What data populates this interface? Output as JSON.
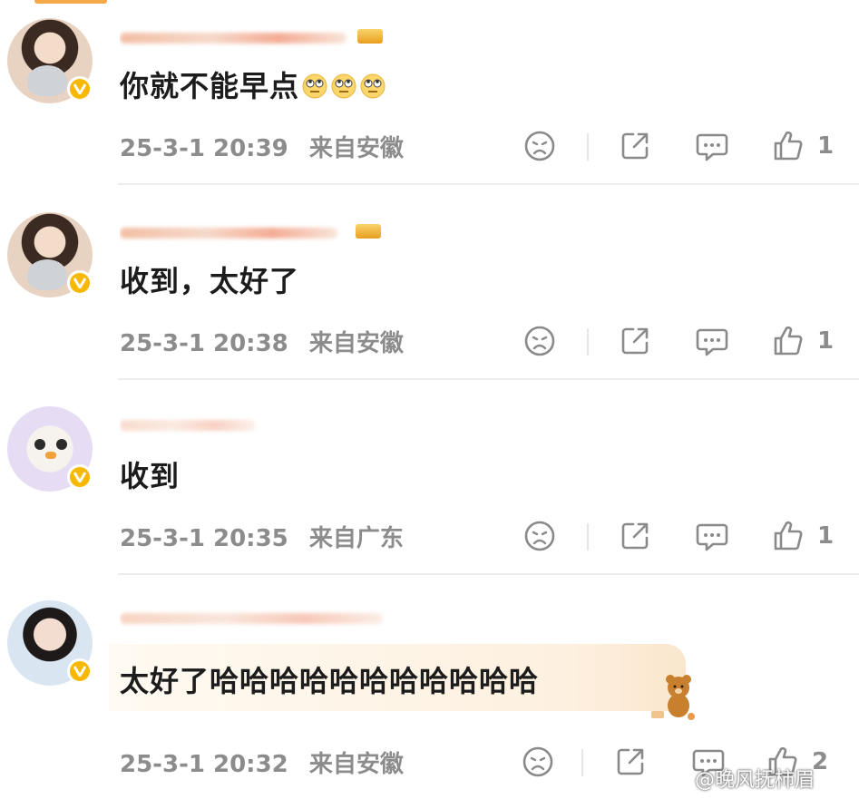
{
  "comments": [
    {
      "text": "你就不能早点",
      "emoji_count": 3,
      "emoji": "face-with-rolling-eyes",
      "time": "25-3-1 20:39",
      "location": "来自安徽",
      "likes": "1"
    },
    {
      "text": "收到，太好了",
      "time": "25-3-1 20:38",
      "location": "来自安徽",
      "likes": "1"
    },
    {
      "text": "收到",
      "time": "25-3-1 20:35",
      "location": "来自广东",
      "likes": "1"
    },
    {
      "text": "太好了哈哈哈哈哈哈哈哈哈哈哈",
      "time": "25-3-1 20:32",
      "location": "来自安徽",
      "likes": "2"
    }
  ],
  "watermark": "@晚风抚柿眉",
  "colors": {
    "accent": "#f6b800",
    "meta_text": "#8c8c8c",
    "bubble": "#fdf0df"
  },
  "icons": [
    "dislike-icon",
    "share-icon",
    "reply-icon",
    "like-icon",
    "verified-badge-icon"
  ]
}
